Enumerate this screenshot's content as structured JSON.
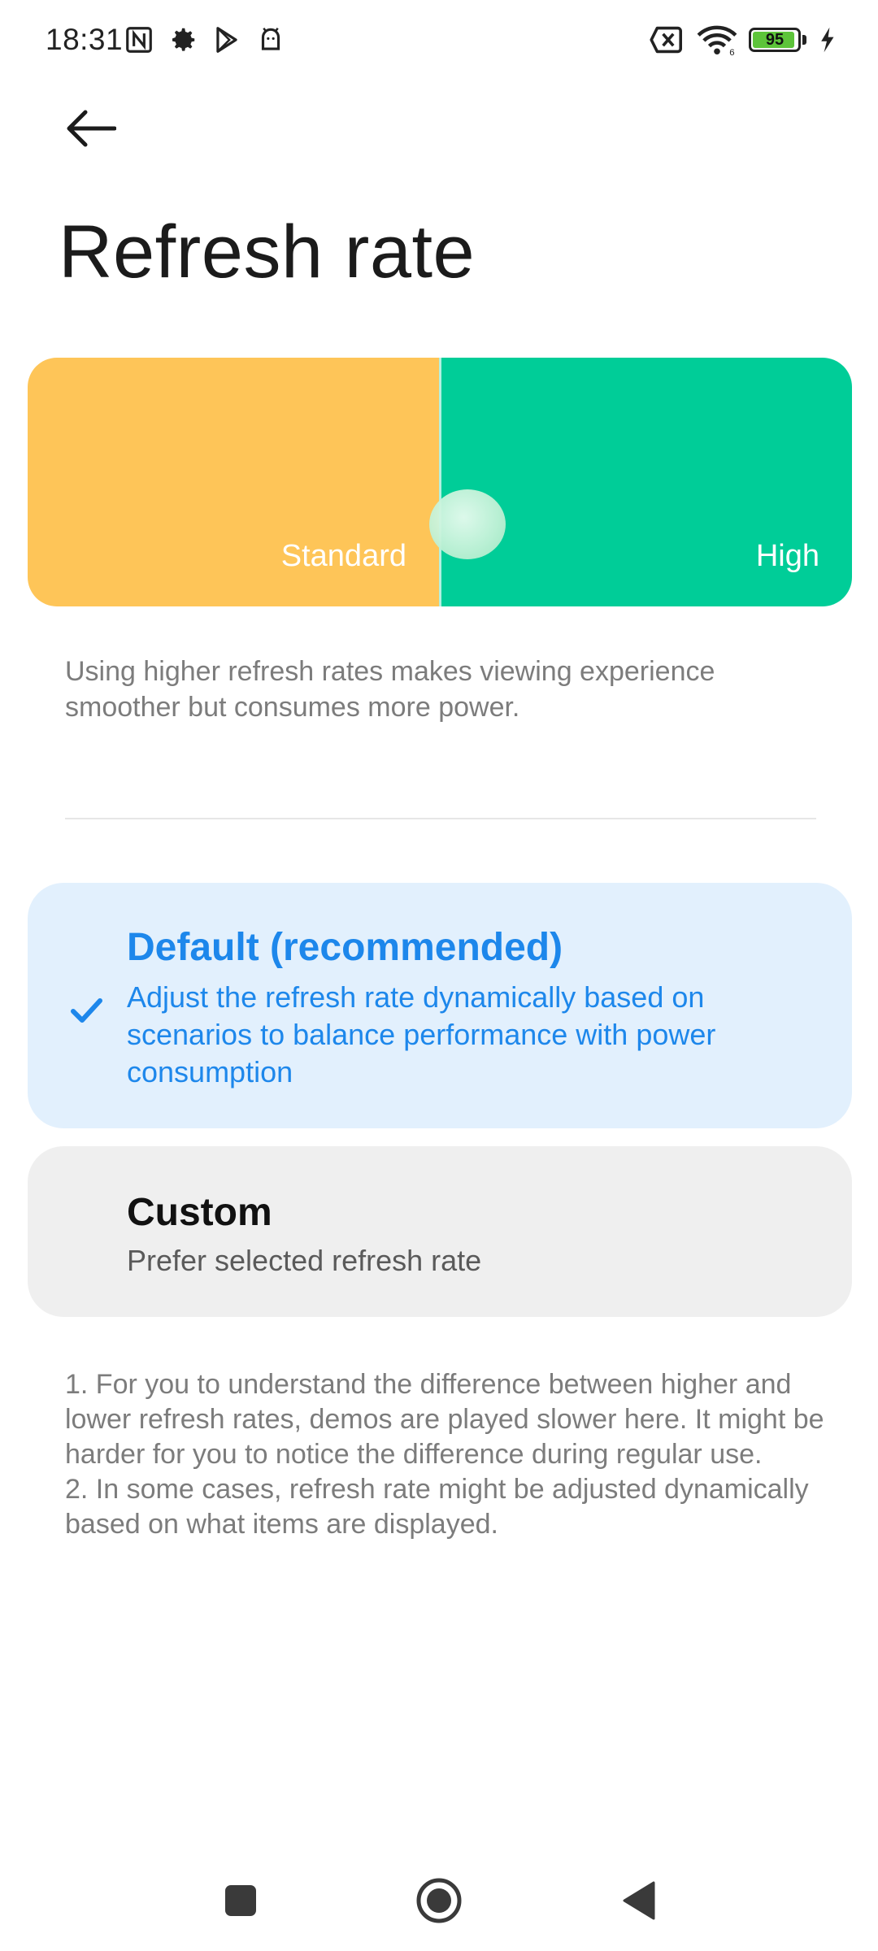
{
  "status_bar": {
    "time": "18:31",
    "left_icons": [
      "nfc-icon",
      "gear-icon",
      "play-store-icon",
      "android-debug-icon"
    ],
    "right_icons": [
      "no-sim-icon",
      "wifi-icon",
      "battery-icon",
      "charging-bolt-icon"
    ],
    "battery_level": "95",
    "battery_percent": 95,
    "battery_color": "#5dc43a"
  },
  "header": {
    "back_icon": "arrow-left-icon",
    "title": "Refresh rate"
  },
  "demo": {
    "standard_label": "Standard",
    "high_label": "High",
    "standard_color": "#fec558",
    "high_color": "#00cd98"
  },
  "description": "Using higher refresh rates makes viewing experience smoother but consumes more power.",
  "options": [
    {
      "title": "Default (recommended)",
      "subtitle": "Adjust the refresh rate dynamically based on scenarios to balance performance with power consumption",
      "selected": true,
      "accent": "#1d87eb"
    },
    {
      "title": "Custom",
      "subtitle": "Prefer selected refresh rate",
      "selected": false
    }
  ],
  "notes": [
    "1. For you to understand the difference between higher and lower refresh rates, demos are played slower here. It might be harder for you to notice the difference during regular use.",
    "2. In some cases, refresh rate might be adjusted dynamically based on what items are displayed."
  ],
  "nav_bar": {
    "icons": [
      "recents-square-icon",
      "home-circle-icon",
      "back-triangle-icon"
    ]
  }
}
